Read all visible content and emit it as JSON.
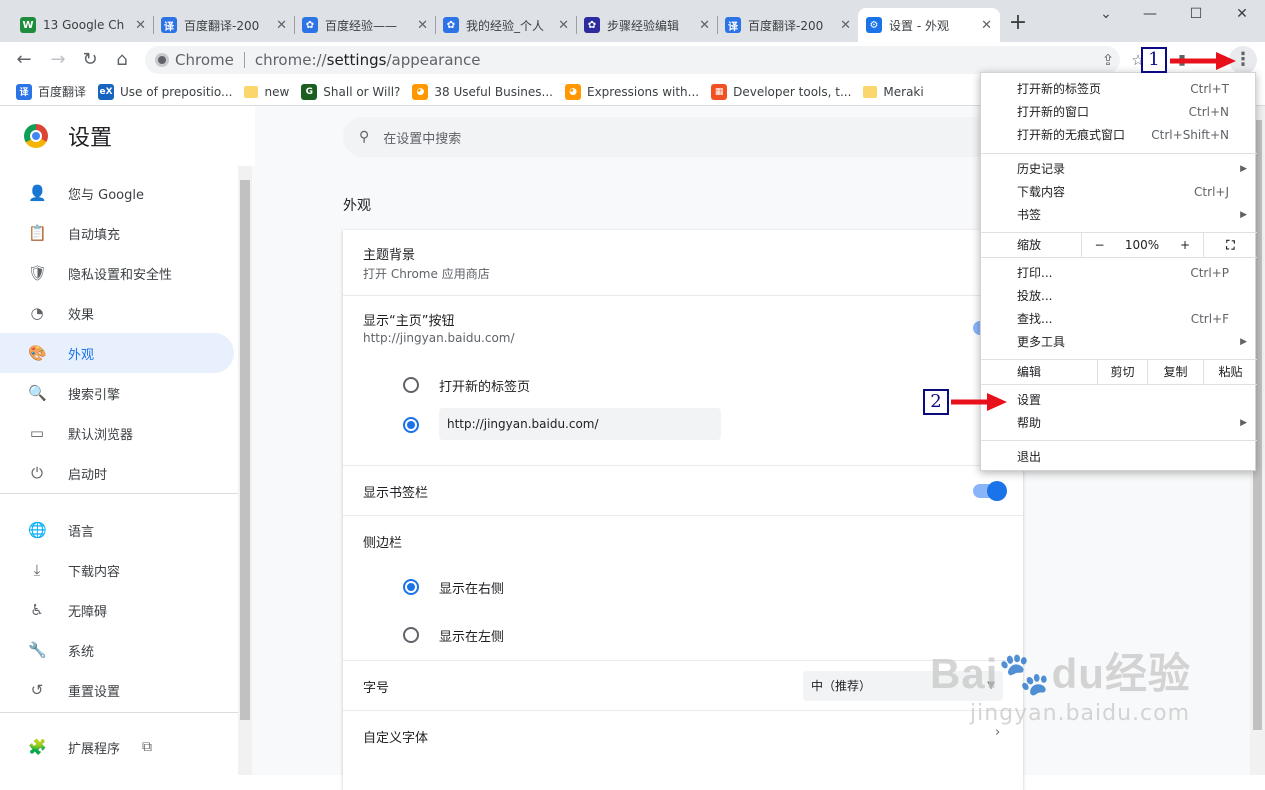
{
  "tabs": [
    {
      "title": "13 Google Ch",
      "fav": "W",
      "color": "#1e8e3e"
    },
    {
      "title": "百度翻译-200",
      "fav": "译",
      "color": "#2c74e6"
    },
    {
      "title": "百度经验——",
      "fav": "✿",
      "color": "#2c74e6"
    },
    {
      "title": "我的经验_个人",
      "fav": "✿",
      "color": "#2c74e6"
    },
    {
      "title": "步骤经验编辑",
      "fav": "✿",
      "color": "#2c2c9e"
    },
    {
      "title": "百度翻译-200",
      "fav": "译",
      "color": "#2c74e6"
    },
    {
      "title": "设置 - 外观",
      "fav": "⚙",
      "color": "#1a73e8"
    }
  ],
  "omnibox": {
    "site": "Chrome",
    "url_prefix": "chrome://",
    "url_host": "settings",
    "url_path": "/appearance"
  },
  "bookmarks": [
    {
      "label": "百度翻译",
      "type": "icon",
      "fav": "译",
      "color": "#2c74e6"
    },
    {
      "label": "Use of prepositio...",
      "type": "icon",
      "fav": "eX",
      "color": "#1565c0"
    },
    {
      "label": "new",
      "type": "folder"
    },
    {
      "label": "Shall or Will?",
      "type": "icon",
      "fav": "G",
      "color": "#1b5e20"
    },
    {
      "label": "38 Useful Busines...",
      "type": "icon",
      "fav": "◕",
      "color": "#ff9800"
    },
    {
      "label": "Expressions with...",
      "type": "icon",
      "fav": "◕",
      "color": "#ff9800"
    },
    {
      "label": "Developer tools, t...",
      "type": "icon",
      "fav": "▦",
      "color": "#f25022"
    },
    {
      "label": "Meraki",
      "type": "folder"
    }
  ],
  "sidebar": {
    "title": "设置",
    "items": [
      {
        "label": "您与 Google",
        "icon": "person-icon",
        "glyph": "👤"
      },
      {
        "label": "自动填充",
        "icon": "clipboard-icon",
        "glyph": "📋"
      },
      {
        "label": "隐私设置和安全性",
        "icon": "shield-icon",
        "glyph": "🛡"
      },
      {
        "label": "效果",
        "icon": "gauge-icon",
        "glyph": "◔"
      },
      {
        "label": "外观",
        "icon": "palette-icon",
        "glyph": "🎨"
      },
      {
        "label": "搜索引擎",
        "icon": "search-icon",
        "glyph": "🔍"
      },
      {
        "label": "默认浏览器",
        "icon": "browser-icon",
        "glyph": "▭"
      },
      {
        "label": "启动时",
        "icon": "power-icon",
        "glyph": "⏻"
      },
      {
        "label": "语言",
        "icon": "globe-icon",
        "glyph": "🌐"
      },
      {
        "label": "下载内容",
        "icon": "download-icon",
        "glyph": "⤓"
      },
      {
        "label": "无障碍",
        "icon": "accessibility-icon",
        "glyph": "♿"
      },
      {
        "label": "系统",
        "icon": "wrench-icon",
        "glyph": "🔧"
      },
      {
        "label": "重置设置",
        "icon": "reset-icon",
        "glyph": "↺"
      },
      {
        "label": "扩展程序",
        "icon": "puzzle-icon",
        "glyph": "🧩"
      }
    ]
  },
  "search": {
    "placeholder": "在设置中搜索"
  },
  "appearance": {
    "section_title": "外观",
    "theme_title": "主题背景",
    "theme_sub": "打开 Chrome 应用商店",
    "home_title": "显示“主页”按钮",
    "home_sub": "http://jingyan.baidu.com/",
    "home_opt_newtab": "打开新的标签页",
    "home_opt_url": "http://jingyan.baidu.com/",
    "bookmarks_bar": "显示书签栏",
    "side_panel": "侧边栏",
    "side_right": "显示在右侧",
    "side_left": "显示在左侧",
    "font_size": "字号",
    "font_size_value": "中（推荐）",
    "custom_fonts": "自定义字体"
  },
  "menu": {
    "new_tab": "打开新的标签页",
    "new_tab_sc": "Ctrl+T",
    "new_window": "打开新的窗口",
    "new_window_sc": "Ctrl+N",
    "incognito": "打开新的无痕式窗口",
    "incognito_sc": "Ctrl+Shift+N",
    "history": "历史记录",
    "downloads": "下载内容",
    "downloads_sc": "Ctrl+J",
    "bookmarks": "书签",
    "zoom": "缩放",
    "zoom_minus": "−",
    "zoom_value": "100%",
    "zoom_plus": "+",
    "print": "打印...",
    "print_sc": "Ctrl+P",
    "cast": "投放...",
    "find": "查找...",
    "find_sc": "Ctrl+F",
    "more_tools": "更多工具",
    "edit": "编辑",
    "cut": "剪切",
    "copy": "复制",
    "paste": "粘贴",
    "settings": "设置",
    "help": "帮助",
    "exit": "退出"
  },
  "annotations": {
    "one": "1",
    "two": "2"
  },
  "watermark": {
    "brand": "Bai",
    "brand2": "du",
    "brand3": "经验",
    "url": "jingyan.baidu.com"
  }
}
